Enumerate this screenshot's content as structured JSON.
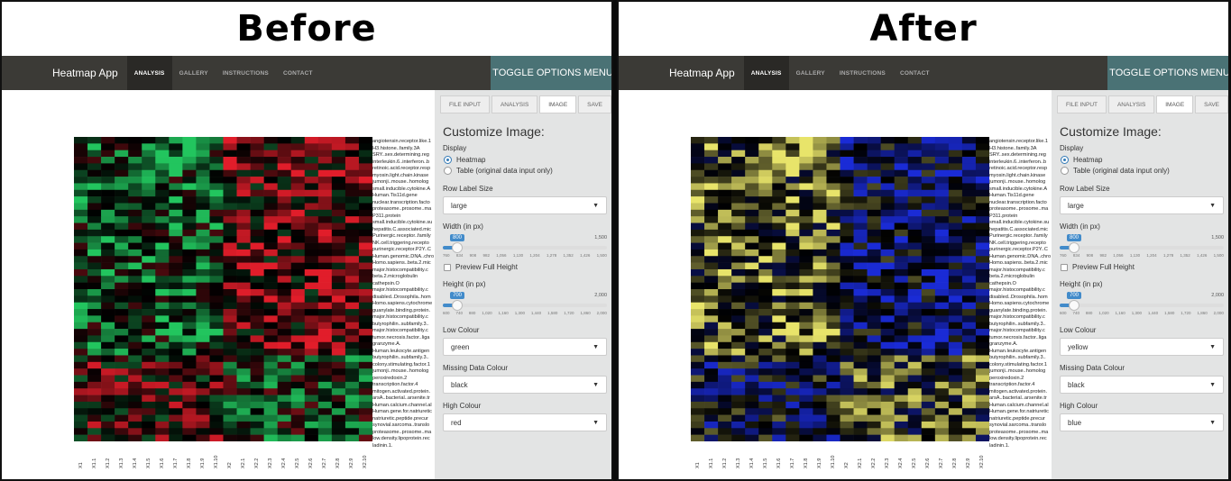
{
  "panels": [
    {
      "title": "Before",
      "app": {
        "brand": "Heatmap App",
        "nav": [
          "ANALYSIS",
          "GALLERY",
          "INSTRUCTIONS",
          "CONTACT"
        ],
        "toggle": "TOGGLE OPTIONS MENU"
      },
      "tabs": [
        "FILE INPUT",
        "ANALYSIS",
        "IMAGE",
        "SAVE"
      ],
      "sidebar": {
        "heading": "Customize Image:",
        "display_label": "Display",
        "display_options": [
          "Heatmap",
          "Table (original data input only)"
        ],
        "row_label_size_label": "Row Label Size",
        "row_label_size_value": "large",
        "width_label": "Width (in px)",
        "width_value": "800",
        "width_max": "1,500",
        "width_ticks": [
          "760",
          "834",
          "908",
          "982",
          "1,056",
          "1,130",
          "1,204",
          "1,278",
          "1,352",
          "1,426",
          "1,500"
        ],
        "preview_label": "Preview Full Height",
        "height_label": "Height (in px)",
        "height_value": "700",
        "height_max": "2,000",
        "height_ticks": [
          "600",
          "740",
          "880",
          "1,020",
          "1,160",
          "1,300",
          "1,440",
          "1,580",
          "1,720",
          "1,860",
          "2,000"
        ],
        "low_colour_label": "Low Colour",
        "low_colour_value": "green",
        "missing_label": "Missing Data Colour",
        "missing_value": "black",
        "high_colour_label": "High Colour",
        "high_colour_value": "red"
      },
      "colors": {
        "low": "#22c55e",
        "high": "#e11d2a",
        "missing": "#000000"
      }
    },
    {
      "title": "After",
      "app": {
        "brand": "Heatmap App",
        "nav": [
          "ANALYSIS",
          "GALLERY",
          "INSTRUCTIONS",
          "CONTACT"
        ],
        "toggle": "TOGGLE OPTIONS MENU"
      },
      "tabs": [
        "FILE INPUT",
        "ANALYSIS",
        "IMAGE",
        "SAVE"
      ],
      "sidebar": {
        "heading": "Customize Image:",
        "display_label": "Display",
        "display_options": [
          "Heatmap",
          "Table (original data input only)"
        ],
        "row_label_size_label": "Row Label Size",
        "row_label_size_value": "large",
        "width_label": "Width (in px)",
        "width_value": "800",
        "width_max": "1,500",
        "width_ticks": [
          "760",
          "834",
          "908",
          "982",
          "1,056",
          "1,130",
          "1,204",
          "1,278",
          "1,352",
          "1,426",
          "1,500"
        ],
        "preview_label": "Preview Full Height",
        "height_label": "Height (in px)",
        "height_value": "700",
        "height_max": "2,000",
        "height_ticks": [
          "600",
          "740",
          "880",
          "1,020",
          "1,160",
          "1,300",
          "1,440",
          "1,580",
          "1,720",
          "1,860",
          "2,000"
        ],
        "low_colour_label": "Low Colour",
        "low_colour_value": "yellow",
        "missing_label": "Missing Data Colour",
        "missing_value": "black",
        "high_colour_label": "High Colour",
        "high_colour_value": "blue"
      },
      "colors": {
        "low": "#e8e46a",
        "high": "#1a2bd6",
        "missing": "#000000"
      }
    }
  ],
  "row_labels": [
    "angiotensin.receptor.like.1",
    "H3.histone..family.3A",
    "SRY..sex.determining.reg",
    "interleukin.6..interferon..b",
    "retinoic.acid.receptor.resp",
    "myosin.light.chain.kinase",
    "jumonji..mouse..homolog",
    "small.inducible.cytokine.A",
    "Human.Tis11d.gene",
    "nuclear.transcription.facto",
    "proteasome..prosome..ma",
    "P311.protein",
    "small.inducible.cytokine.su",
    "hepatitis.C.associated.mic",
    "Purinergic.receptor..family",
    "NK.cell.triggering.recepto",
    "purinergic.receptor.P2Y..C",
    "Human.genomic.DNA..chro",
    "Homo.sapiens..beta.2.mic",
    "major.histocompatibility.c",
    "beta.2.microglobulin",
    "cathepsin.O",
    "major.histocompatibility.c",
    "disabled..Drosophila..hom",
    "Homo.sapiens.cytochrome",
    "guanylate.binding.protein.",
    "major.histocompatibility.c",
    "butyrophilin..subfamily.3..",
    "major.histocompatibility.c",
    "tumor.necrosis.factor..liga",
    "granzyme.A.",
    "Human.leukocyte.antigen",
    "butyrophilin..subfamily.3..",
    "colony.stimulating.factor.1",
    "jumonji..mouse..homolog",
    "peroxiredoxin.2",
    "transcription.factor.4",
    "mitogen.activated.protein.",
    "arsA..bacterial..arsenite.tr",
    "Human.calcium.channel.al",
    "Human.gene.for.natriuretic",
    "natriuretic.peptide.precur",
    "synovial.sarcoma..translo",
    "proteasome..prosome..ma",
    "low.density.lipoprotein.rec",
    "ladinin.1."
  ],
  "col_labels": [
    "X1",
    "X1.1",
    "X1.2",
    "X1.3",
    "X1.4",
    "X1.5",
    "X1.6",
    "X1.7",
    "X1.8",
    "X1.9",
    "X1.10",
    "X2",
    "X2.1",
    "X2.2",
    "X2.3",
    "X2.4",
    "X2.5",
    "X2.6",
    "X2.7",
    "X2.8",
    "X2.9",
    "X2.10"
  ]
}
